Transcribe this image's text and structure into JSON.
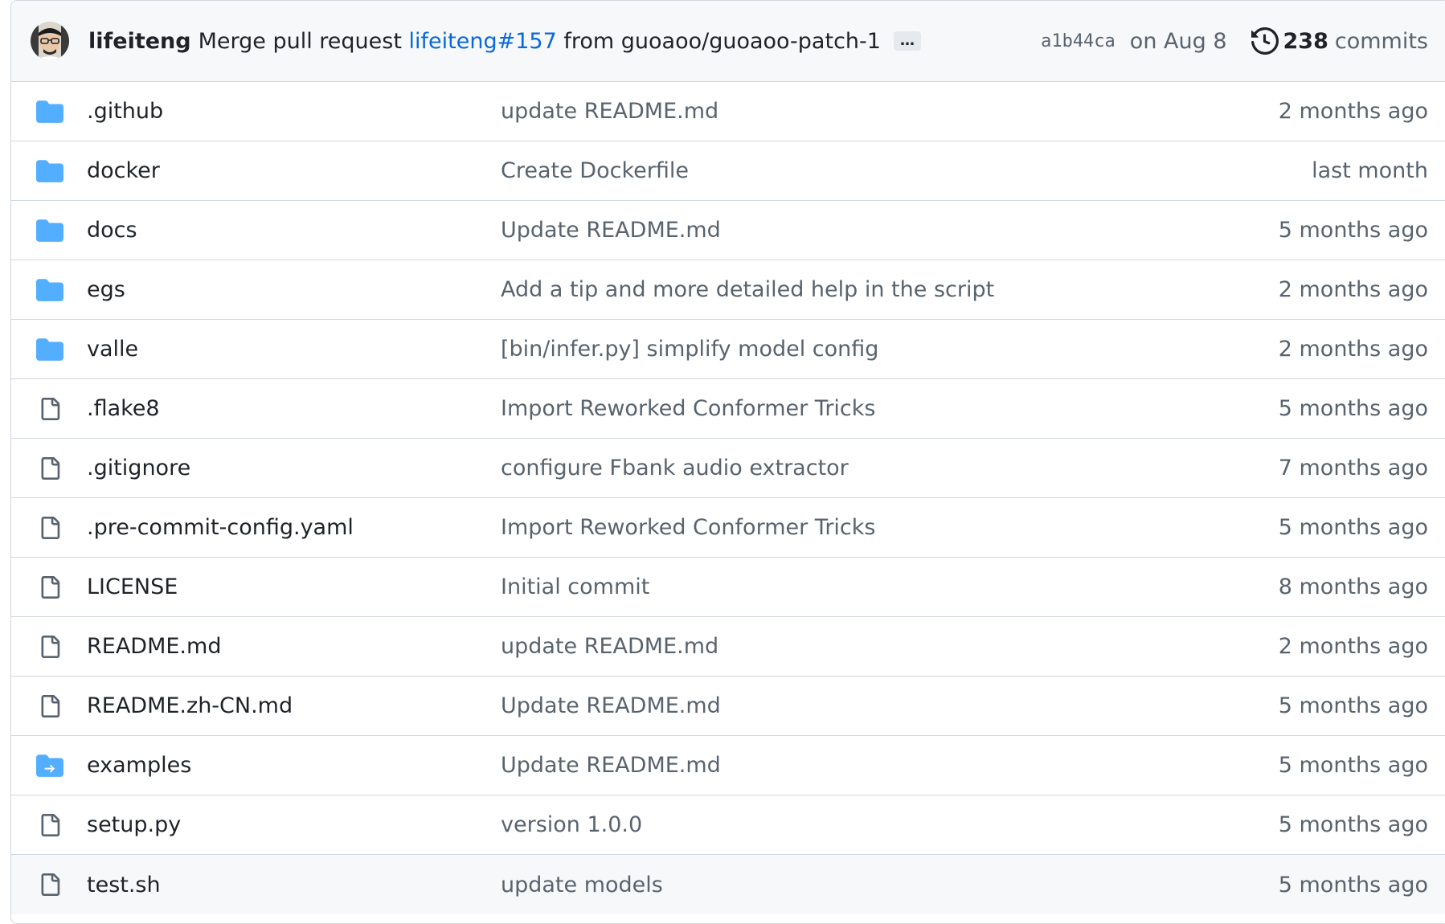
{
  "latest_commit": {
    "author": "lifeiteng",
    "message_prefix": "Merge pull request ",
    "pr_link": "lifeiteng#157",
    "message_suffix": " from guoaoo/guoaoo-patch-1",
    "ellipsis": "…",
    "sha": "a1b44ca",
    "date": "on Aug 8",
    "commit_count": "238",
    "commits_label": "commits",
    "avatar_icon": "user-avatar",
    "history_icon": "history-icon"
  },
  "files": [
    {
      "name": ".github",
      "type": "folder",
      "icon": "folder-icon",
      "message": "update README.md",
      "age": "2 months ago"
    },
    {
      "name": "docker",
      "type": "folder",
      "icon": "folder-icon",
      "message": "Create Dockerfile",
      "age": "last month"
    },
    {
      "name": "docs",
      "type": "folder",
      "icon": "folder-icon",
      "message": "Update README.md",
      "age": "5 months ago"
    },
    {
      "name": "egs",
      "type": "folder",
      "icon": "folder-icon",
      "message": "Add a tip and more detailed help in the script",
      "age": "2 months ago"
    },
    {
      "name": "valle",
      "type": "folder",
      "icon": "folder-icon",
      "message": "[bin/infer.py] simplify model config",
      "age": "2 months ago"
    },
    {
      "name": ".flake8",
      "type": "file",
      "icon": "file-icon",
      "message": "Import Reworked Conformer Tricks",
      "age": "5 months ago"
    },
    {
      "name": ".gitignore",
      "type": "file",
      "icon": "file-icon",
      "message": "configure Fbank audio extractor",
      "age": "7 months ago"
    },
    {
      "name": ".pre-commit-config.yaml",
      "type": "file",
      "icon": "file-icon",
      "message": "Import Reworked Conformer Tricks",
      "age": "5 months ago"
    },
    {
      "name": "LICENSE",
      "type": "file",
      "icon": "file-icon",
      "message": "Initial commit",
      "age": "8 months ago"
    },
    {
      "name": "README.md",
      "type": "file",
      "icon": "file-icon",
      "message": "update README.md",
      "age": "2 months ago"
    },
    {
      "name": "README.zh-CN.md",
      "type": "file",
      "icon": "file-icon",
      "message": "Update README.md",
      "age": "5 months ago"
    },
    {
      "name": "examples",
      "type": "symlink",
      "icon": "symlink-folder-icon",
      "message": "Update README.md",
      "age": "5 months ago"
    },
    {
      "name": "setup.py",
      "type": "file",
      "icon": "file-icon",
      "message": "version 1.0.0",
      "age": "5 months ago"
    },
    {
      "name": "test.sh",
      "type": "file",
      "icon": "file-icon",
      "message": "update models",
      "age": "5 months ago"
    }
  ],
  "colors": {
    "folder": "#54aeff",
    "file": "#59636e",
    "link": "#0969da",
    "muted": "#59636e",
    "header_bg": "#f6f8fa",
    "border": "#d0d7de"
  }
}
